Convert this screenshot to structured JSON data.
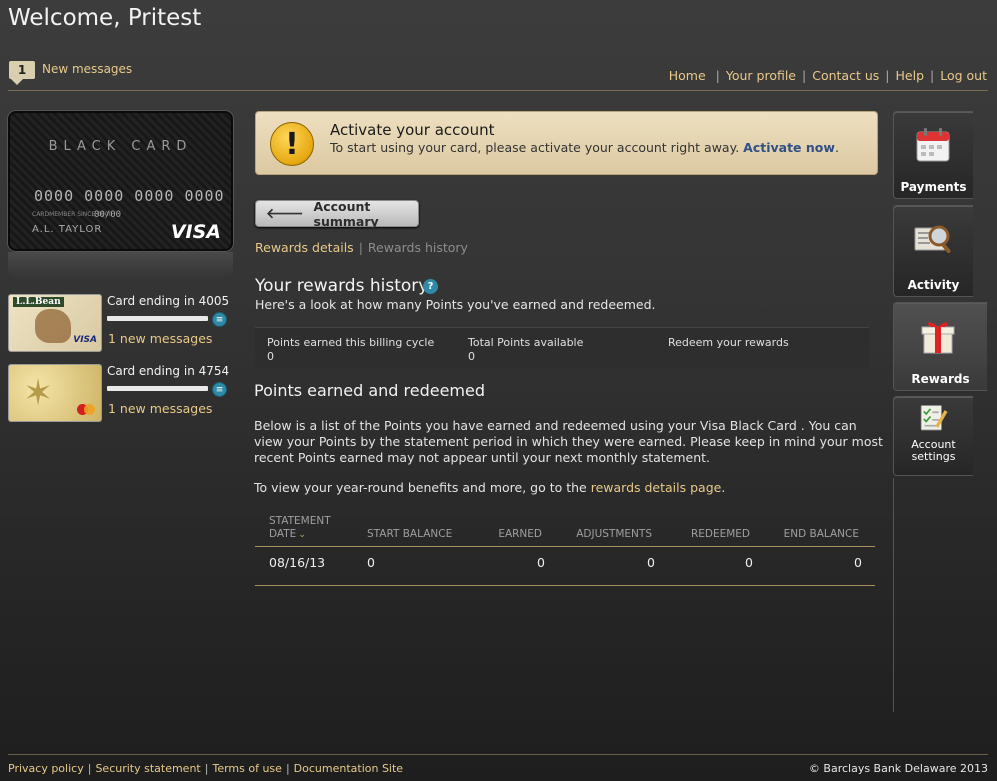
{
  "header": {
    "welcome": "Welcome, Pritest",
    "message_count": "1",
    "messages_link": "New messages",
    "nav": [
      "Home",
      "Your profile",
      "Contact us",
      "Help",
      "Log out"
    ]
  },
  "cards": {
    "black_card": {
      "brand": "BLACK CARD",
      "number": "0000 0000 0000 0000",
      "small_label": "CARDMEMBER SINCE 0000",
      "small_expiry": "00/00",
      "name": "A.L. TAYLOR",
      "network": "VISA"
    },
    "secondary": [
      {
        "logo_text": "L.L.Bean",
        "network": "VISA",
        "ending": "Card ending in 4005",
        "messages": "1 new messages",
        "progress": 1.0
      },
      {
        "logo_text": "",
        "network": "MasterCard",
        "ending": "Card ending in 4754",
        "messages": "1 new messages",
        "progress": 1.0
      }
    ]
  },
  "alert": {
    "title": "Activate your account",
    "text": "To start using your card, please activate your account right away.",
    "link": "Activate now",
    "period": "."
  },
  "back_button": "Account summary",
  "subnav": {
    "active": "Rewards details",
    "separator": "|",
    "inactive": "Rewards history"
  },
  "rewards_history": {
    "title": "Your rewards history",
    "help": "?",
    "subtitle": "Here's a look at how many Points you've earned and redeemed.",
    "points_earned_label": "Points earned this billing cycle",
    "points_earned_value": "0",
    "total_points_label": "Total Points available",
    "total_points_value": "0",
    "redeem_link": "Redeem your rewards"
  },
  "points_section": {
    "title": "Points earned and redeemed",
    "paragraph": "Below is a list of the Points you have earned and redeemed using your Visa Black Card . You can view your Points by the statement period in which they were earned. Please keep in mind your most recent Points earned may not appear until your next monthly statement.",
    "para2_prefix": "To view your year-round benefits and more, go to the ",
    "para2_link": "rewards details page",
    "para2_suffix": "."
  },
  "table": {
    "headers": {
      "statement_date_line1": "STATEMENT",
      "statement_date_line2": "DATE",
      "start_balance": "START BALANCE",
      "earned": "EARNED",
      "adjustments": "ADJUSTMENTS",
      "redeemed": "REDEEMED",
      "end_balance": "END BALANCE"
    },
    "rows": [
      {
        "date": "08/16/13",
        "start_balance": "0",
        "earned": "0",
        "adjustments": "0",
        "redeemed": "0",
        "end_balance": "0"
      }
    ]
  },
  "right_nav": [
    {
      "label": "Payments",
      "icon": "calendar-icon"
    },
    {
      "label": "Activity",
      "icon": "magnifier-receipt-icon"
    },
    {
      "label": "Rewards",
      "icon": "gift-icon"
    },
    {
      "label_line1": "Account",
      "label_line2": "settings",
      "icon": "checklist-pencil-icon"
    }
  ],
  "footer": {
    "links": [
      "Privacy policy",
      "Security statement",
      "Terms of use",
      "Documentation Site"
    ],
    "copyright": "© Barclays Bank Delaware 2013"
  },
  "colors": {
    "accent_gold": "#e8c98a",
    "info_blue": "#2e8aa6",
    "alert_bg": "#eddfc0",
    "link_blue": "#2f4f86"
  }
}
